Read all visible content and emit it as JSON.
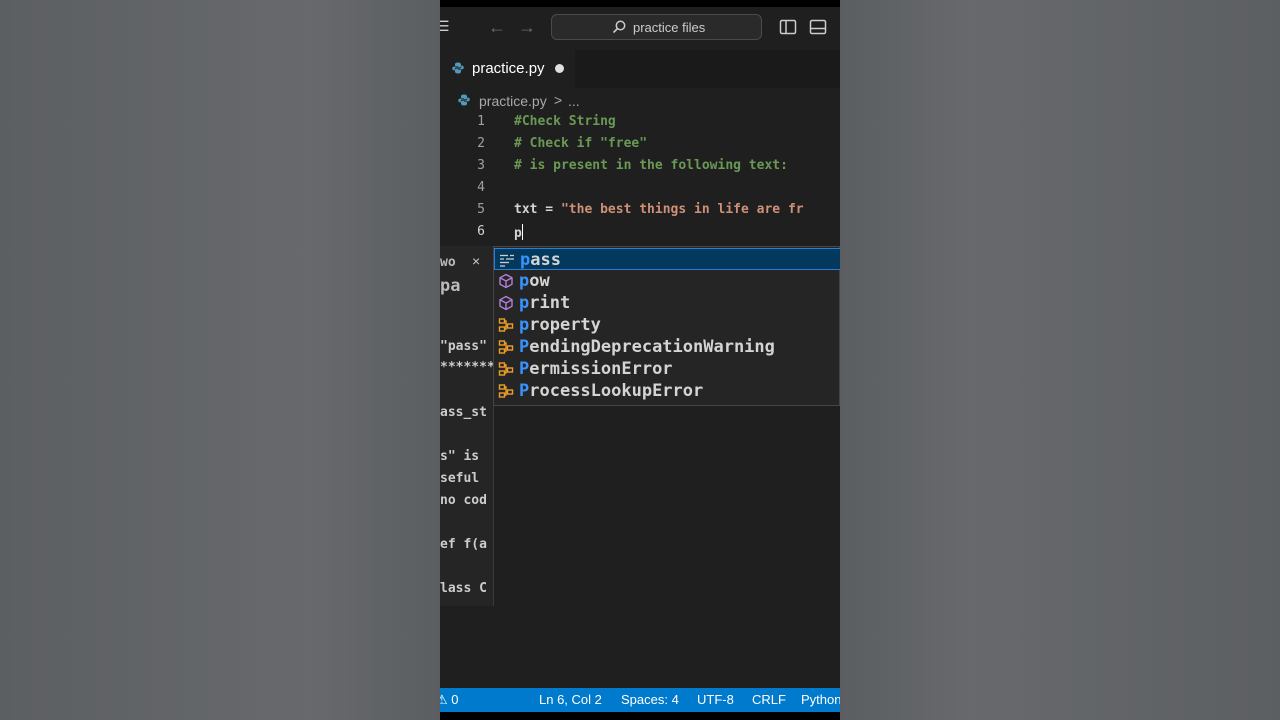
{
  "titlebar": {
    "search_text": "practice files"
  },
  "tab": {
    "label": "practice.py"
  },
  "breadcrumb": {
    "file": "practice.py",
    "separator": ">",
    "more": "..."
  },
  "editor": {
    "lines": [
      {
        "num": "1",
        "text": "#Check String"
      },
      {
        "num": "2",
        "text": "# Check if \"free\""
      },
      {
        "num": "3",
        "text": "# is present in the following text:"
      },
      {
        "num": "4",
        "text": ""
      },
      {
        "num": "5",
        "text_ident": "txt = ",
        "text_str": "\"the best things in life are fr"
      },
      {
        "num": "6",
        "text": "p"
      }
    ]
  },
  "doc_panel": {
    "close": "×",
    "lines": [
      "wo",
      "pa",
      "\"pass\"",
      "*******",
      "ass_st",
      "s\" is",
      "seful",
      "no cod",
      "ef f(a",
      "lass C"
    ]
  },
  "suggestions": [
    {
      "match": "p",
      "rest": "ass",
      "kind": "keyword",
      "selected": true
    },
    {
      "match": "p",
      "rest": "ow",
      "kind": "function",
      "selected": false
    },
    {
      "match": "p",
      "rest": "rint",
      "kind": "function",
      "selected": false
    },
    {
      "match": "p",
      "rest": "roperty",
      "kind": "class",
      "selected": false
    },
    {
      "match": "P",
      "rest": "endingDeprecationWarning",
      "kind": "class",
      "selected": false
    },
    {
      "match": "P",
      "rest": "ermissionError",
      "kind": "class",
      "selected": false
    },
    {
      "match": "P",
      "rest": "rocessLookupError",
      "kind": "class",
      "selected": false
    }
  ],
  "statusbar": {
    "problems": "⚠ 0",
    "position": "Ln 6, Col 2",
    "spaces": "Spaces: 4",
    "encoding": "UTF-8",
    "eol": "CRLF",
    "language": "Python"
  },
  "colors": {
    "accent": "#007acc",
    "comment": "#6a9955",
    "string": "#ce9178",
    "match": "#3794ff",
    "selected_bg": "#04395e"
  }
}
